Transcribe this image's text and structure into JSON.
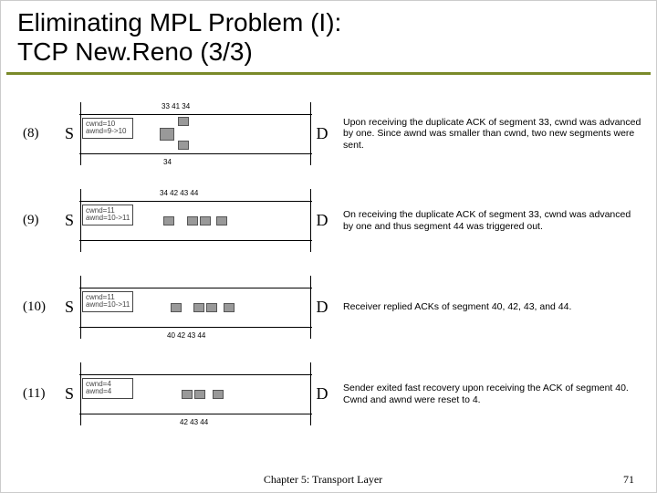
{
  "title_line1": "Eliminating MPL Problem (I):",
  "title_line2": "TCP New.Reno (3/3)",
  "rows": [
    {
      "num": "(8)",
      "s": "S",
      "d": "D",
      "info1": "cwnd=10",
      "info2": "awnd=9->10",
      "top_ticks": "33  41  34",
      "bot_ticks": "34",
      "caption": "Upon receiving the duplicate ACK of segment 33, cwnd was advanced by one. Since awnd was smaller than cwnd, two new segments were sent."
    },
    {
      "num": "(9)",
      "s": "S",
      "d": "D",
      "info1": "cwnd=11",
      "info2": "awnd=10->11",
      "top_ticks": "34   42 43  44",
      "bot_ticks": "",
      "caption": "On receiving the duplicate ACK of segment 33, cwnd was advanced by one and thus segment 44 was triggered out."
    },
    {
      "num": "(10)",
      "s": "S",
      "d": "D",
      "info1": "cwnd=11",
      "info2": "awnd=10->11",
      "top_ticks": "",
      "bot_ticks": "40  42 43  44",
      "caption": "Receiver replied ACKs of segment 40, 42, 43, and 44."
    },
    {
      "num": "(11)",
      "s": "S",
      "d": "D",
      "info1": "cwnd=4",
      "info2": "awnd=4",
      "top_ticks": "",
      "bot_ticks": "42 43  44",
      "caption": "Sender exited fast recovery upon receiving the ACK of segment 40. Cwnd and awnd were reset to 4."
    }
  ],
  "footer_center": "Chapter 5: Transport Layer",
  "footer_right": "71"
}
